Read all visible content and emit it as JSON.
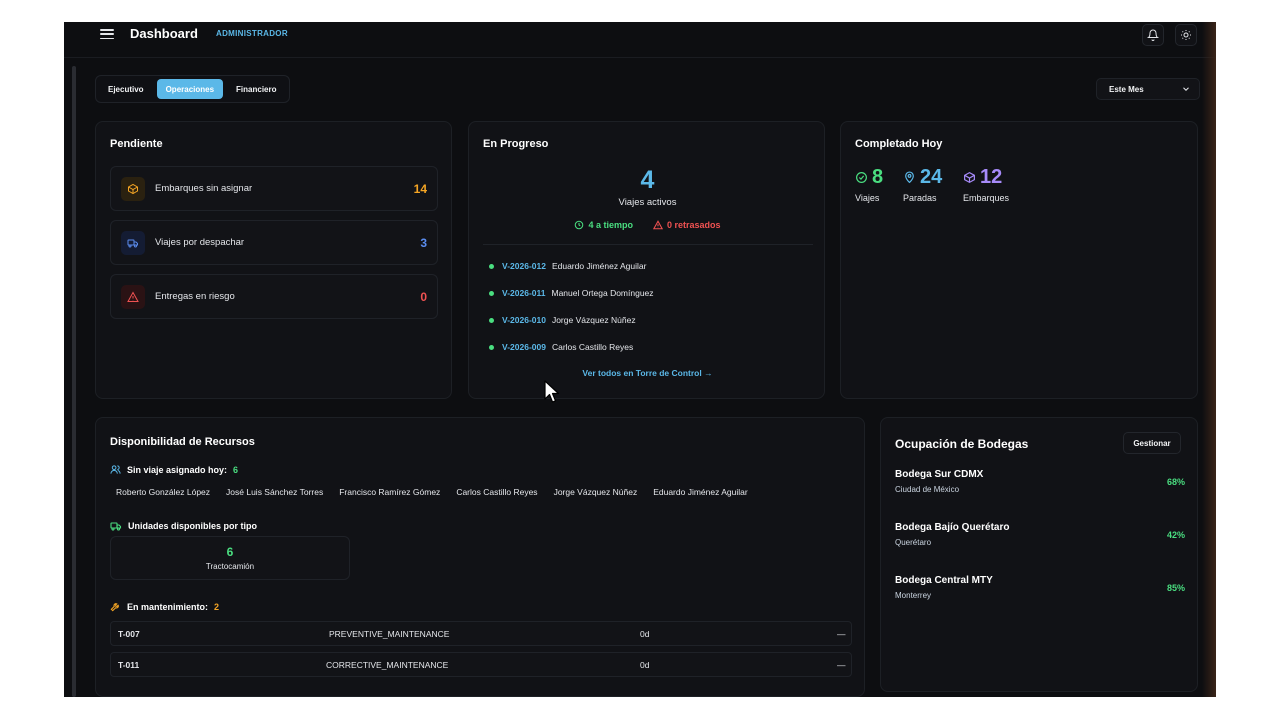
{
  "header": {
    "title": "Dashboard",
    "role": "ADMINISTRADOR",
    "icons": [
      "menu-icon",
      "bell-icon",
      "sun-icon"
    ]
  },
  "tabs": [
    {
      "label": "Ejecutivo",
      "active": false
    },
    {
      "label": "Operaciones",
      "active": true
    },
    {
      "label": "Financiero",
      "active": false
    }
  ],
  "period_select": {
    "value": "Este Mes"
  },
  "pending": {
    "title": "Pendiente",
    "items": [
      {
        "label": "Embarques sin asignar",
        "count": "14",
        "color": "#f5a524",
        "icon": "box-icon"
      },
      {
        "label": "Viajes por despachar",
        "count": "3",
        "color": "#5b8def",
        "icon": "truck-icon"
      },
      {
        "label": "Entregas en riesgo",
        "count": "0",
        "color": "#f05252",
        "icon": "warning-icon"
      }
    ]
  },
  "in_progress": {
    "title": "En Progreso",
    "active_count": "4",
    "active_label": "Viajes activos",
    "on_time": "4 a tiempo",
    "delayed": "0 retrasados",
    "trips": [
      {
        "id": "V-2026-012",
        "driver": "Eduardo Jiménez Aguilar"
      },
      {
        "id": "V-2026-011",
        "driver": "Manuel Ortega Domínguez"
      },
      {
        "id": "V-2026-010",
        "driver": "Jorge Vázquez Núñez"
      },
      {
        "id": "V-2026-009",
        "driver": "Carlos Castillo Reyes"
      }
    ],
    "see_all": "Ver todos en Torre de Control →"
  },
  "completed_today": {
    "title": "Completado Hoy",
    "metrics": [
      {
        "value": "8",
        "label": "Viajes",
        "color": "#4ade80",
        "icon": "check-circle-icon"
      },
      {
        "value": "24",
        "label": "Paradas",
        "color": "#5bb8e8",
        "icon": "map-pin-icon"
      },
      {
        "value": "12",
        "label": "Embarques",
        "color": "#a78bfa",
        "icon": "cube-icon"
      }
    ]
  },
  "resources": {
    "title": "Disponibilidad de Recursos",
    "no_trip_label": "Sin viaje asignado hoy:",
    "no_trip_count": "6",
    "drivers": [
      "Roberto González López",
      "José Luis Sánchez Torres",
      "Francisco Ramírez Gómez",
      "Carlos Castillo Reyes",
      "Jorge Vázquez Núñez",
      "Eduardo Jiménez Aguilar"
    ],
    "units_label": "Unidades disponibles por tipo",
    "unit_count": "6",
    "unit_type": "Tractocamión",
    "maintenance_label": "En mantenimiento:",
    "maintenance_count": "2",
    "maintenance": [
      {
        "unit": "T-007",
        "type": "PREVENTIVE_MAINTENANCE",
        "days": "0d",
        "end": "—"
      },
      {
        "unit": "T-011",
        "type": "CORRECTIVE_MAINTENANCE",
        "days": "0d",
        "end": "—"
      }
    ]
  },
  "warehouses": {
    "title": "Ocupación de Bodegas",
    "manage": "Gestionar",
    "items": [
      {
        "name": "Bodega Sur CDMX",
        "city": "Ciudad de México",
        "occupancy": "68%"
      },
      {
        "name": "Bodega Bajío Querétaro",
        "city": "Querétaro",
        "occupancy": "42%"
      },
      {
        "name": "Bodega Central MTY",
        "city": "Monterrey",
        "occupancy": "85%"
      }
    ]
  }
}
